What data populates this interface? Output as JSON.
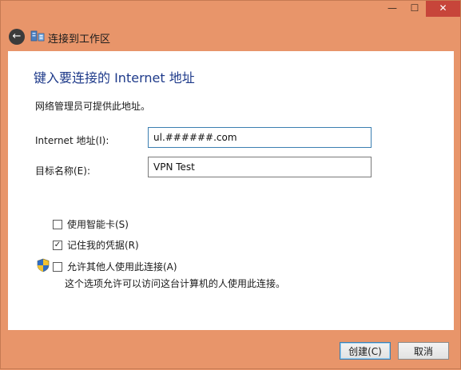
{
  "window": {
    "caption_buttons": {
      "minimize": "—",
      "maximize": "☐",
      "close": "✕"
    }
  },
  "header": {
    "back_icon": "←",
    "title": "连接到工作区"
  },
  "content": {
    "heading": "键入要连接的 Internet 地址",
    "description": "网络管理员可提供此地址。",
    "internet_address": {
      "label": "Internet 地址(I):",
      "value": "ul.######.com"
    },
    "destination_name": {
      "label": "目标名称(E):",
      "value": "VPN Test"
    },
    "options": [
      {
        "label": "使用智能卡(S)",
        "checked": false
      },
      {
        "label": "记住我的凭据(R)",
        "checked": true
      },
      {
        "label": "允许其他人使用此连接(A)",
        "checked": false
      }
    ],
    "allow_note": "这个选项允许可以访问这台计算机的人使用此连接。"
  },
  "footer": {
    "create_label": "创建(C)",
    "cancel_label": "取消"
  }
}
